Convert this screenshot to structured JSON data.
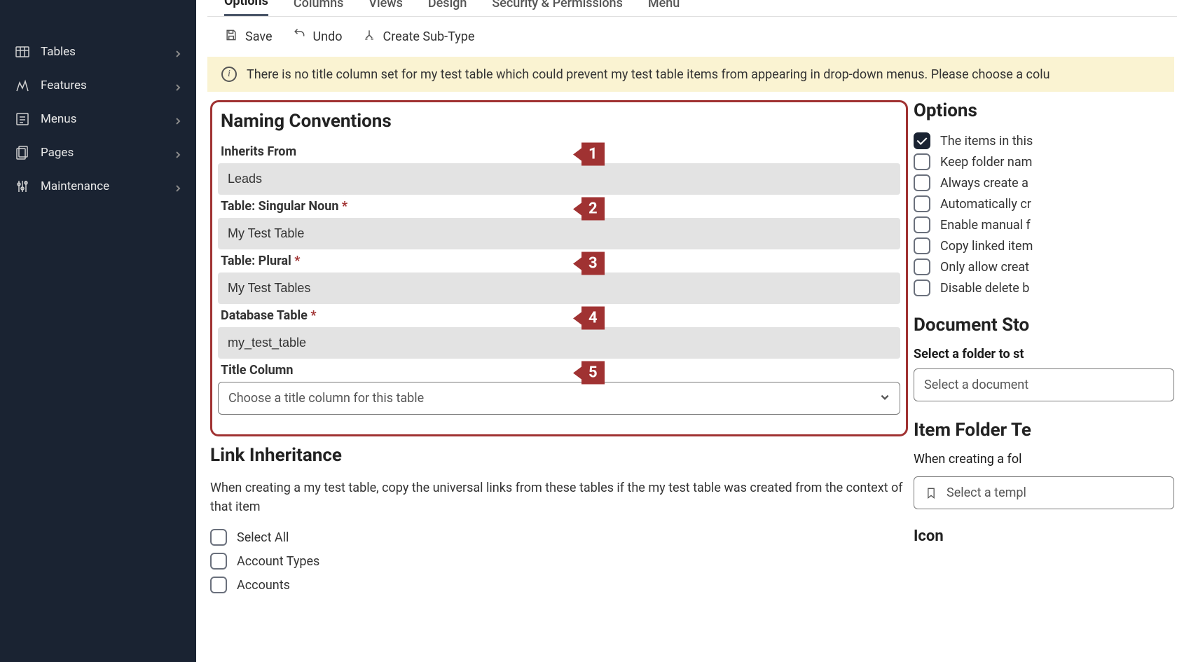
{
  "sidebar": {
    "items": [
      {
        "label": "Tables"
      },
      {
        "label": "Features"
      },
      {
        "label": "Menus"
      },
      {
        "label": "Pages"
      },
      {
        "label": "Maintenance"
      }
    ]
  },
  "tabs": [
    {
      "label": "Options",
      "active": true
    },
    {
      "label": "Columns"
    },
    {
      "label": "Views"
    },
    {
      "label": "Design"
    },
    {
      "label": "Security & Permissions"
    },
    {
      "label": "Menu"
    }
  ],
  "toolbar": {
    "save": "Save",
    "undo": "Undo",
    "create_sub": "Create Sub-Type"
  },
  "banner": {
    "text": "There is no title column set for my test table which could prevent my test table items from appearing in drop-down menus. Please choose a colu"
  },
  "naming": {
    "title": "Naming Conventions",
    "fields": [
      {
        "label": "Inherits From",
        "required": false,
        "value": "Leads",
        "annot": "1"
      },
      {
        "label": "Table: Singular Noun",
        "required": true,
        "value": "My Test Table",
        "annot": "2"
      },
      {
        "label": "Table: Plural",
        "required": true,
        "value": "My Test Tables",
        "annot": "3"
      },
      {
        "label": "Database Table",
        "required": true,
        "value": "my_test_table",
        "annot": "4"
      }
    ],
    "title_column": {
      "label": "Title Column",
      "placeholder": "Choose a title column for this table",
      "annot": "5"
    }
  },
  "link_inherit": {
    "title": "Link Inheritance",
    "desc": "When creating a my test table, copy the universal links from these tables if the my test table was created from the context of that item",
    "select_all": "Select All",
    "items": [
      {
        "label": "Account Types"
      },
      {
        "label": "Accounts"
      }
    ]
  },
  "options": {
    "title": "Options",
    "items": [
      {
        "label": "The items in this",
        "checked": true
      },
      {
        "label": "Keep folder nam",
        "checked": false
      },
      {
        "label": "Always create a",
        "checked": false
      },
      {
        "label": "Automatically cr",
        "checked": false
      },
      {
        "label": "Enable manual f",
        "checked": false
      },
      {
        "label": "Copy linked item",
        "checked": false
      },
      {
        "label": "Only allow creat",
        "checked": false
      },
      {
        "label": "Disable delete b",
        "checked": false
      }
    ]
  },
  "doc_storage": {
    "title": "Document Sto",
    "label": "Select a folder to st",
    "placeholder": "Select a document"
  },
  "folder_template": {
    "title": "Item Folder Te",
    "desc": "When creating a fol",
    "placeholder": "Select a templ"
  },
  "icon_section": {
    "title": "Icon"
  }
}
